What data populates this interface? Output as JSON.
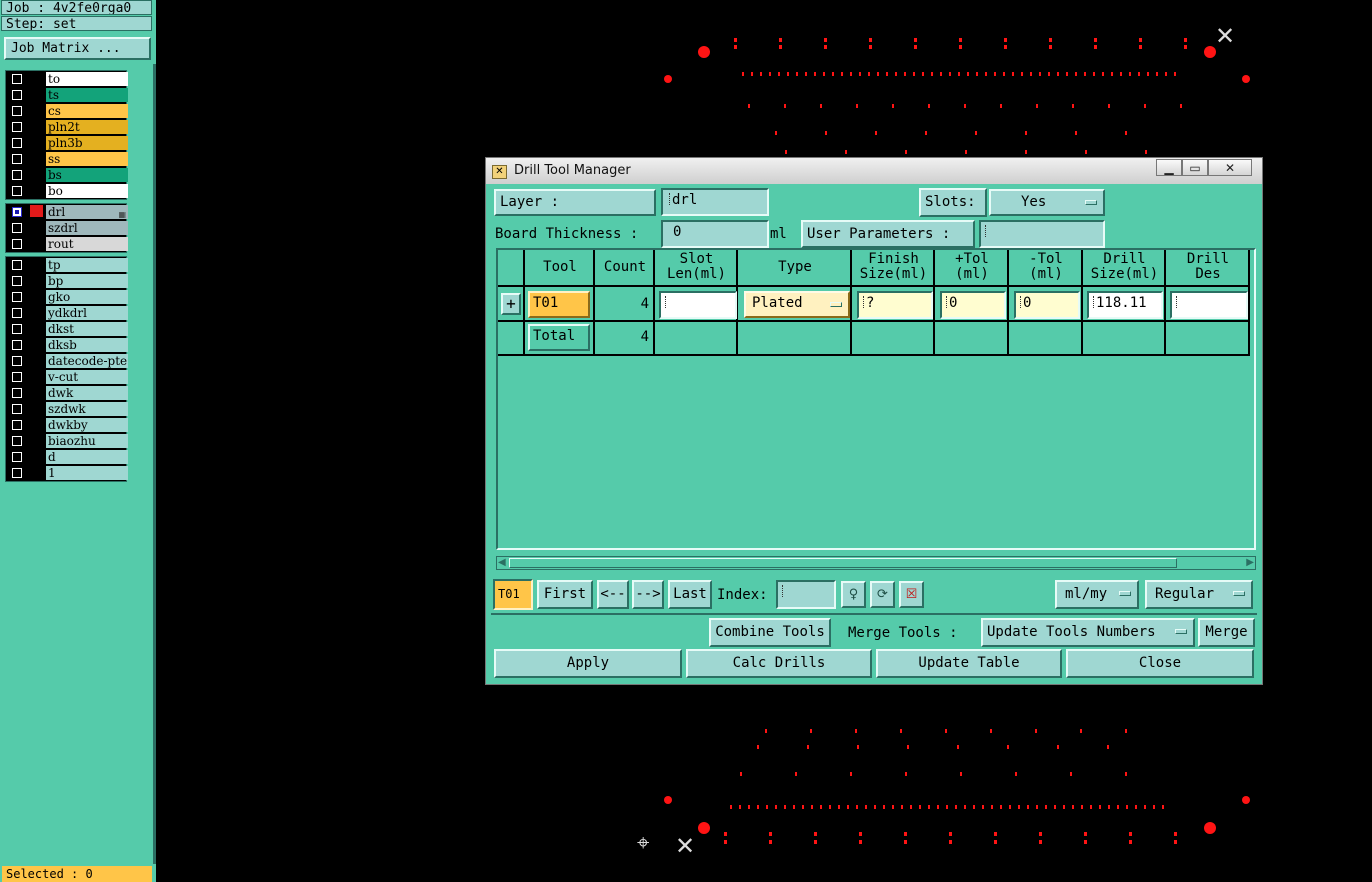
{
  "left_panel": {
    "job": "Job : 4v2fe0rga0",
    "step": "Step: set",
    "job_matrix": "Job Matrix ...",
    "board_layers": [
      {
        "name": "to",
        "color": "#ffffff"
      },
      {
        "name": "ts",
        "color": "#13a37a"
      },
      {
        "name": "cs",
        "color": "#ffc548"
      },
      {
        "name": "pln2t",
        "color": "#e4b020"
      },
      {
        "name": "pln3b",
        "color": "#e4b020"
      },
      {
        "name": "ss",
        "color": "#ffc548"
      },
      {
        "name": "bs",
        "color": "#13a37a"
      },
      {
        "name": "bo",
        "color": "#ffffff"
      }
    ],
    "drill_layers": [
      {
        "name": "drl",
        "color": "#9fb8bc",
        "active": true
      },
      {
        "name": "szdrl",
        "color": "#9fb8bc"
      },
      {
        "name": "rout",
        "color": "#d8d8d8"
      }
    ],
    "misc_layers": [
      {
        "name": "tp"
      },
      {
        "name": "bp"
      },
      {
        "name": "gko"
      },
      {
        "name": "ydkdrl"
      },
      {
        "name": "dkst"
      },
      {
        "name": "dksb"
      },
      {
        "name": "datecode-pte"
      },
      {
        "name": "v-cut"
      },
      {
        "name": "dwk"
      },
      {
        "name": "szdwk"
      },
      {
        "name": "dwkby"
      },
      {
        "name": "biaozhu"
      },
      {
        "name": "d"
      },
      {
        "name": "1"
      }
    ],
    "misc_color": "#9fd7d2",
    "selected": "Selected : 0"
  },
  "dialog": {
    "title": "Drill Tool Manager",
    "layer_label": "Layer       :",
    "layer_value": "drl",
    "slots_label": "Slots:",
    "slots_value": "Yes",
    "board_thickness_label": "Board Thickness :",
    "board_thickness_value": "0",
    "board_thickness_unit": "ml",
    "user_params_label": "User Parameters :",
    "user_params_value": "",
    "table": {
      "headers": [
        {
          "l1": "Tool",
          "l2": ""
        },
        {
          "l1": "Count",
          "l2": ""
        },
        {
          "l1": "Slot",
          "l2": "Len(ml)"
        },
        {
          "l1": "Type",
          "l2": ""
        },
        {
          "l1": "Finish",
          "l2": "Size(ml)"
        },
        {
          "l1": "+Tol",
          "l2": "(ml)"
        },
        {
          "l1": "-Tol",
          "l2": "(ml)"
        },
        {
          "l1": "Drill",
          "l2": "Size(ml)"
        },
        {
          "l1": "Drill",
          "l2": "Des"
        }
      ],
      "rows": [
        {
          "tool": "T01",
          "count": "4",
          "slot_len": "",
          "type": "Plated",
          "finish_size": "?",
          "plus_tol": "0",
          "minus_tol": "0",
          "drill_size": "118.11",
          "drill_des": ""
        }
      ],
      "total": {
        "label": "Total",
        "count": "4"
      }
    },
    "nav": {
      "current_tool": "T01",
      "first": "First",
      "prev": "<--",
      "next": "-->",
      "last": "Last",
      "index_label": "Index:",
      "index_value": "",
      "units": "ml/my",
      "mode": "Regular"
    },
    "merge": {
      "combine": "Combine Tools",
      "merge_label": "Merge Tools :",
      "merge_option": "Update Tools Numbers",
      "merge_btn": "Merge"
    },
    "actions": {
      "apply": "Apply",
      "calc": "Calc Drills",
      "update": "Update Table",
      "close": "Close"
    }
  }
}
